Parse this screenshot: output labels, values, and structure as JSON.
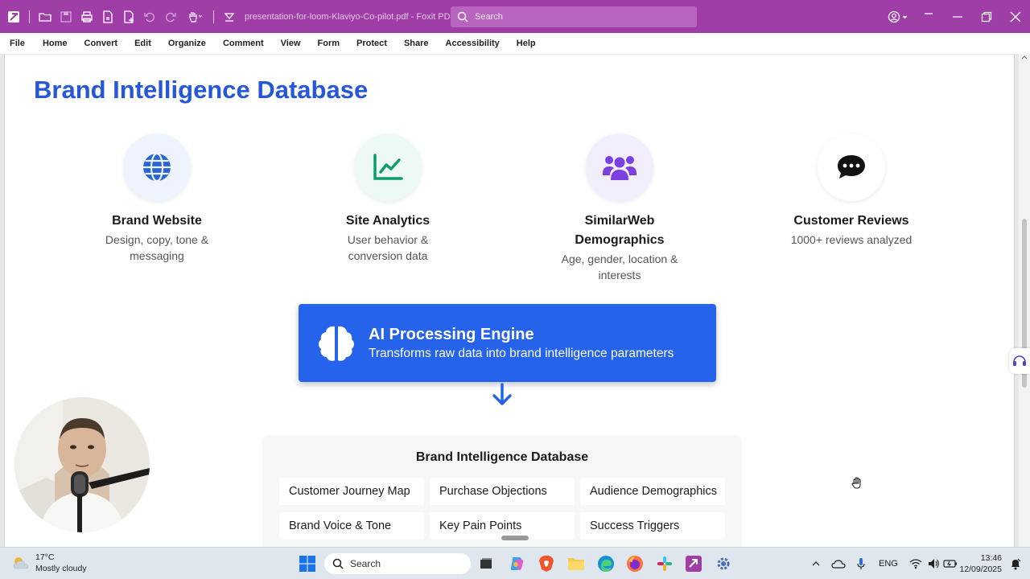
{
  "titlebar": {
    "document_title": "presentation-for-loom-Klaviyo-Co-pilot.pdf - Foxit PDF...",
    "search_placeholder": "Search"
  },
  "menu": [
    "File",
    "Home",
    "Convert",
    "Edit",
    "Organize",
    "Comment",
    "View",
    "Form",
    "Protect",
    "Share",
    "Accessibility",
    "Help"
  ],
  "slide": {
    "title": "Brand Intelligence Database",
    "sources": [
      {
        "name": "Brand Website",
        "desc": "Design, copy, tone & messaging",
        "icon": "globe-icon",
        "icon_color": "#2a63d8",
        "circle_bg": "#eef3fd"
      },
      {
        "name": "Site Analytics",
        "desc": "User behavior & conversion data",
        "icon": "chart-line-icon",
        "icon_color": "#109b6d",
        "circle_bg": "#edf9f4"
      },
      {
        "name": "SimilarWeb Demographics",
        "desc": "Age, gender, location & interests",
        "icon": "users-icon",
        "icon_color": "#7c3fe0",
        "circle_bg": "#f3eefc"
      },
      {
        "name": "Customer Reviews",
        "desc": "1000+ reviews analyzed",
        "icon": "comments-icon",
        "icon_color": "#111111",
        "circle_bg": "#ffffff"
      }
    ],
    "engine": {
      "title": "AI Processing Engine",
      "subtitle": "Transforms raw data into brand intelligence parameters",
      "color": "#2563eb"
    },
    "database": {
      "title": "Brand Intelligence Database",
      "items": [
        "Customer Journey Map",
        "Purchase Objections",
        "Audience Demographics",
        "Brand Voice & Tone",
        "Key Pain Points",
        "Success Triggers"
      ]
    }
  },
  "taskbar": {
    "weather": {
      "temp": "17°C",
      "condition": "Mostly cloudy"
    },
    "search_label": "Search",
    "language": "ENG",
    "time": "13:46",
    "date": "12/09/2025"
  }
}
